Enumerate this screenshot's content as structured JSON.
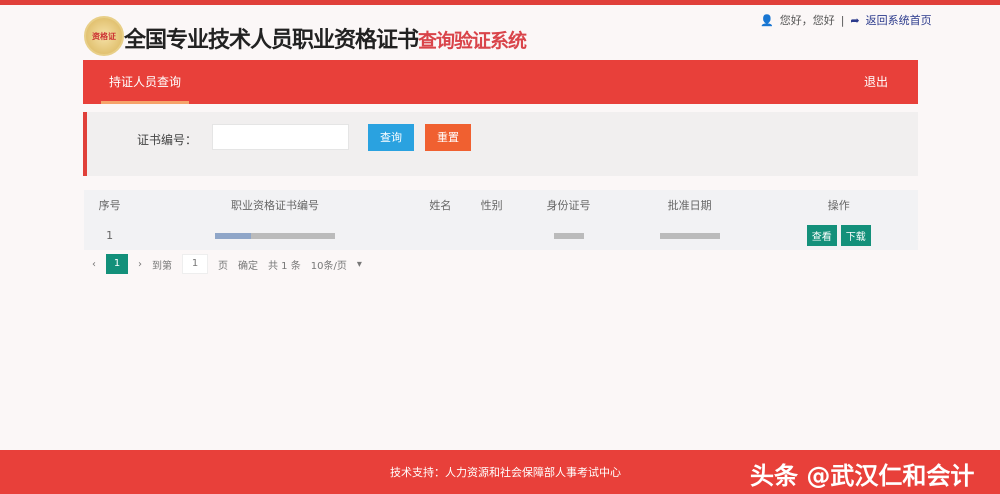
{
  "header": {
    "logo_text": "资格证",
    "title": "全国专业技术人员职业资格证书",
    "subtitle": "查询验证系统",
    "greeting": "您好，您好",
    "home_link": "返回系统首页"
  },
  "nav": {
    "tab": "持证人员查询",
    "logout": "退出"
  },
  "search": {
    "label": "证书编号：",
    "value": "",
    "query": "查询",
    "reset": "重置"
  },
  "table": {
    "headers": [
      "序号",
      "职业资格证书编号",
      "姓名",
      "性别",
      "身份证号",
      "批准日期",
      "操作"
    ],
    "rows": [
      {
        "index": "1",
        "view": "查看",
        "download": "下载"
      }
    ]
  },
  "pager": {
    "page": "1",
    "goto": "到第",
    "page_input": "1",
    "page_unit": "页",
    "confirm": "确定",
    "total": "共 1 条",
    "per_page": "10条/页"
  },
  "footer": {
    "text": "技术支持：人力资源和社会保障部人事考试中心",
    "watermark": "头条 @武汉仁和会计"
  }
}
